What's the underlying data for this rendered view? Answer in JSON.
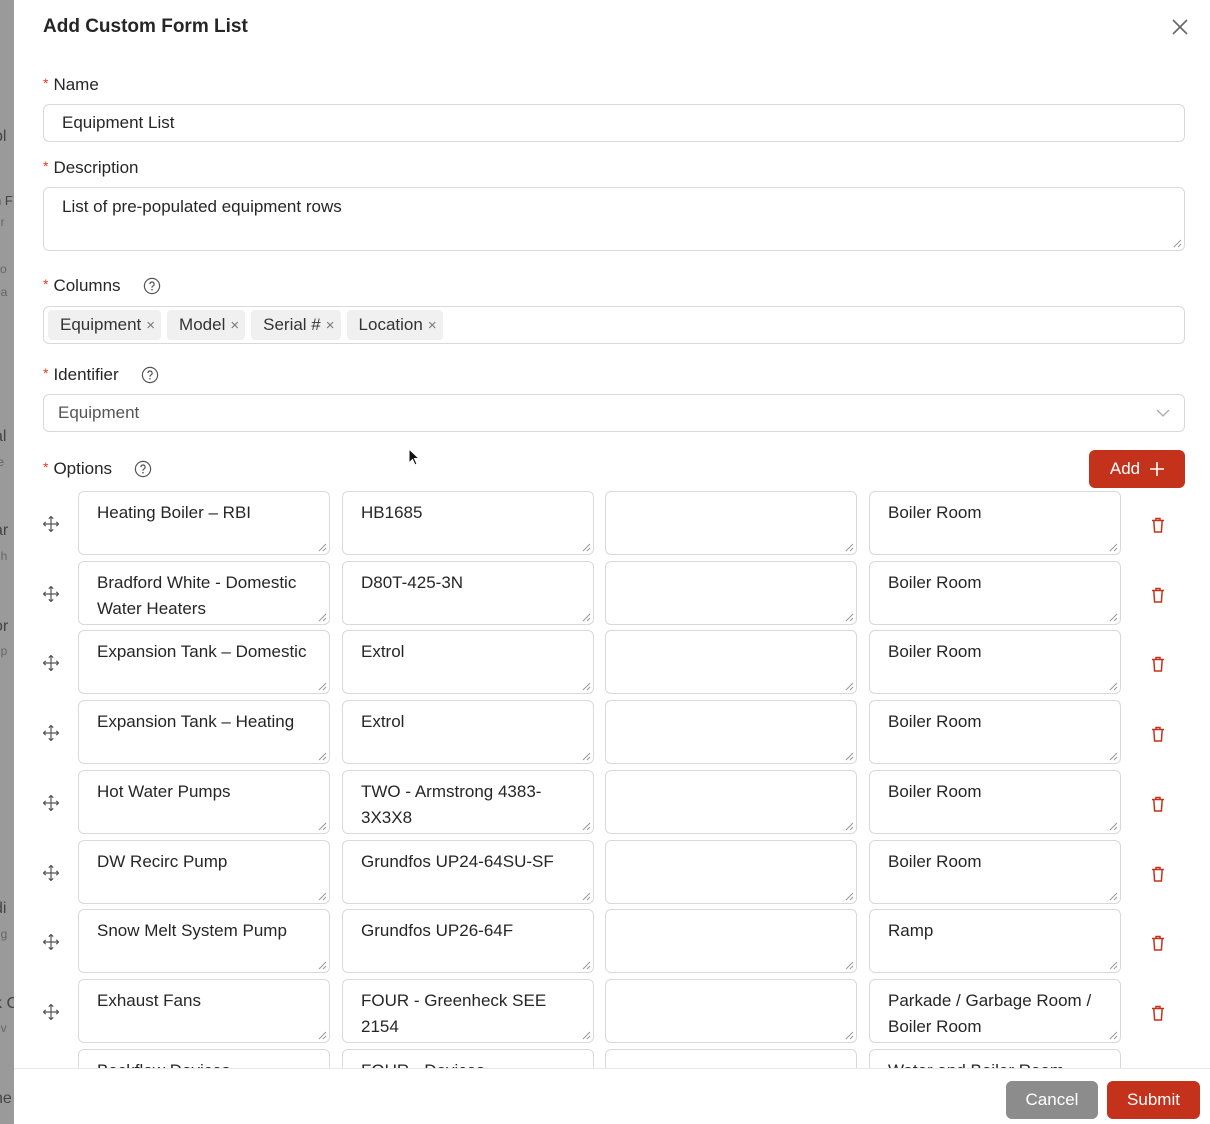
{
  "modal": {
    "title": "Add Custom Form List"
  },
  "fields": {
    "name": {
      "label": "Name",
      "value": "Equipment List"
    },
    "description": {
      "label": "Description",
      "value": "List of pre-populated equipment rows"
    },
    "columns": {
      "label": "Columns",
      "tags": [
        "Equipment",
        "Model",
        "Serial #",
        "Location"
      ]
    },
    "identifier": {
      "label": "Identifier",
      "value": "Equipment"
    },
    "options": {
      "label": "Options",
      "add_label": "Add"
    }
  },
  "rows": [
    [
      "Heating Boiler – RBI",
      "HB1685",
      "",
      "Boiler Room"
    ],
    [
      "Bradford White - Domestic Water Heaters",
      "D80T-425-3N",
      "",
      "Boiler Room"
    ],
    [
      "Expansion Tank – Domestic",
      "Extrol",
      "",
      "Boiler Room"
    ],
    [
      "Expansion Tank – Heating",
      "Extrol",
      "",
      "Boiler Room"
    ],
    [
      "Hot Water Pumps",
      "TWO - Armstrong 4383-3X3X8",
      "",
      "Boiler Room"
    ],
    [
      "DW Recirc Pump",
      "Grundfos UP24-64SU-SF",
      "",
      "Boiler Room"
    ],
    [
      "Snow Melt System Pump",
      "Grundfos UP26-64F",
      "",
      "Ramp"
    ],
    [
      "Exhaust Fans",
      "FOUR - Greenheck SEE 2154",
      "",
      "Parkade / Garbage Room / Boiler Room"
    ],
    [
      "Backflow Devices",
      "FOUR - Devices",
      "",
      "Water and Boiler Room"
    ]
  ],
  "footer": {
    "cancel": "Cancel",
    "submit": "Submit"
  },
  "colors": {
    "primary": "#c4321c",
    "required": "#e03b24",
    "cancel": "#8c8c8c"
  }
}
